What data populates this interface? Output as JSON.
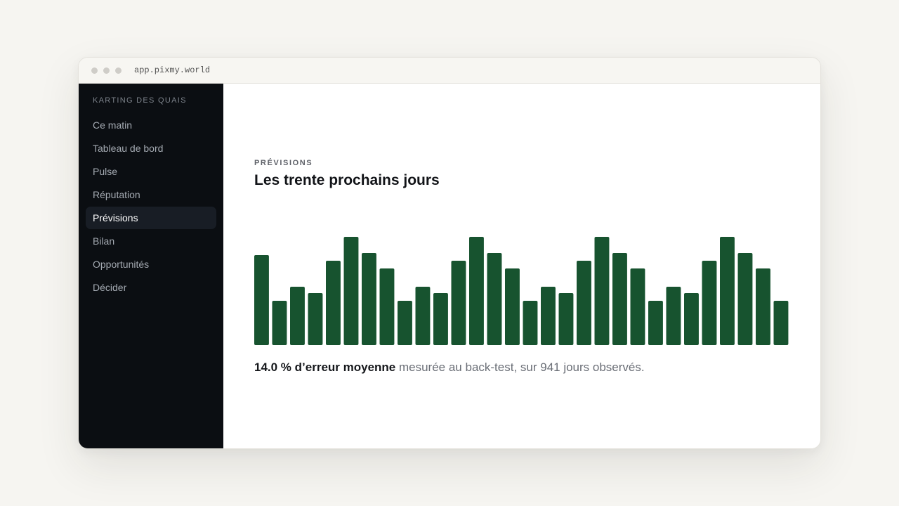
{
  "window": {
    "url": "app.pixmy.world"
  },
  "sidebar": {
    "brand": "KARTING DES QUAIS",
    "items": [
      {
        "label": "Ce matin",
        "active": false
      },
      {
        "label": "Tableau de bord",
        "active": false
      },
      {
        "label": "Pulse",
        "active": false
      },
      {
        "label": "Réputation",
        "active": false
      },
      {
        "label": "Prévisions",
        "active": true
      },
      {
        "label": "Bilan",
        "active": false
      },
      {
        "label": "Opportunités",
        "active": false
      },
      {
        "label": "Décider",
        "active": false
      }
    ]
  },
  "main": {
    "eyebrow": "PRÉVISIONS",
    "title": "Les trente prochains jours",
    "summary_bold": "14.0 % d’erreur moyenne",
    "summary_rest": " mesurée au back-test, sur 941 jours observés."
  },
  "colors": {
    "bar": "#17532f",
    "sidebar_bg": "#0b0e12",
    "sidebar_active_bg": "#181d25"
  },
  "chart_data": {
    "type": "bar",
    "values": [
      0.83,
      0.41,
      0.54,
      0.48,
      0.78,
      1.0,
      0.85,
      0.71,
      0.41,
      0.54,
      0.48,
      0.78,
      1.0,
      0.85,
      0.71,
      0.41,
      0.54,
      0.48,
      0.78,
      1.0,
      0.85,
      0.71,
      0.41,
      0.54,
      0.48,
      0.78,
      1.0,
      0.85,
      0.71,
      0.41
    ],
    "ylim": [
      0,
      1
    ],
    "grid": false,
    "legend": "none"
  }
}
